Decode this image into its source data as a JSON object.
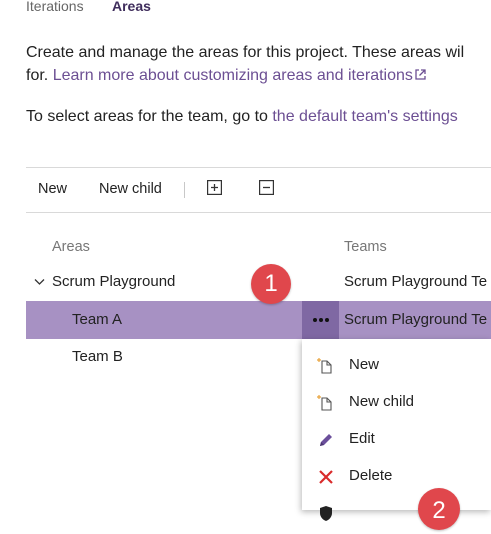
{
  "tabs": [
    {
      "label": "Iterations",
      "active": false
    },
    {
      "label": "Areas",
      "active": true
    }
  ],
  "description": {
    "text1": "Create and manage the areas for this project. These areas wil",
    "text2_prefix": "for. ",
    "learn_more_link": "Learn more about customizing areas and iterations",
    "text3_prefix": "To select areas for the team, go to ",
    "team_settings_link": "the default team's settings"
  },
  "toolbar": {
    "new_label": "New",
    "new_child_label": "New child",
    "expand_icon": "expand-all-icon",
    "collapse_icon": "collapse-all-icon"
  },
  "columns": {
    "areas": "Areas",
    "teams": "Teams"
  },
  "rows": [
    {
      "name": "Scrum Playground",
      "team": "Scrum Playground Te",
      "expanded": true,
      "selected": false
    },
    {
      "name": "Team A",
      "team": "Scrum Playground Te",
      "selected": true
    },
    {
      "name": "Team B",
      "team": "",
      "selected": false
    }
  ],
  "callouts": [
    "1",
    "2"
  ],
  "context_menu": {
    "items": [
      {
        "label": "New",
        "icon": "new-document-icon"
      },
      {
        "label": "New child",
        "icon": "new-child-document-icon"
      },
      {
        "label": "Edit",
        "icon": "pencil-icon"
      },
      {
        "label": "Delete",
        "icon": "close-icon"
      }
    ]
  },
  "colors": {
    "selected_row": "#a791c3",
    "more_button": "#7f68a3",
    "link": "#6c4f93",
    "callout": "#e0474c",
    "delete_icon": "#d92b2b",
    "edit_icon": "#6b4f9b"
  }
}
